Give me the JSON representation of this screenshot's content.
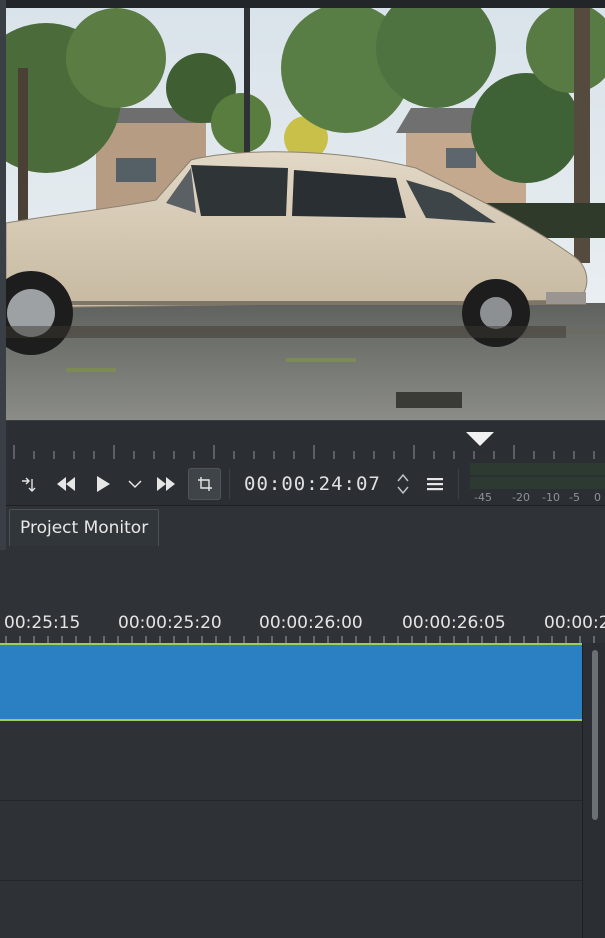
{
  "transport": {
    "timecode": "00:00:24:07",
    "vu_labels": [
      "-45",
      "-20",
      "-10",
      "-5",
      "0"
    ]
  },
  "tabs": {
    "project_monitor": "Project Monitor"
  },
  "timeline": {
    "ruler_labels": [
      "00:25:15",
      "00:00:25:20",
      "00:00:26:00",
      "00:00:26:05",
      "00:00:2"
    ]
  },
  "icons": {
    "zone_in_out": "arrow-to-line-icon",
    "rewind": "rewind-icon",
    "play": "play-icon",
    "play_menu": "chevron-down-icon",
    "forward": "fast-forward-icon",
    "crop": "crop-icon",
    "timecode_spin": "spin-arrows-icon",
    "menu": "hamburger-menu-icon"
  },
  "colors": {
    "clip": "#2a80c3",
    "clip_border": "#9bd152",
    "background": "#232629"
  }
}
